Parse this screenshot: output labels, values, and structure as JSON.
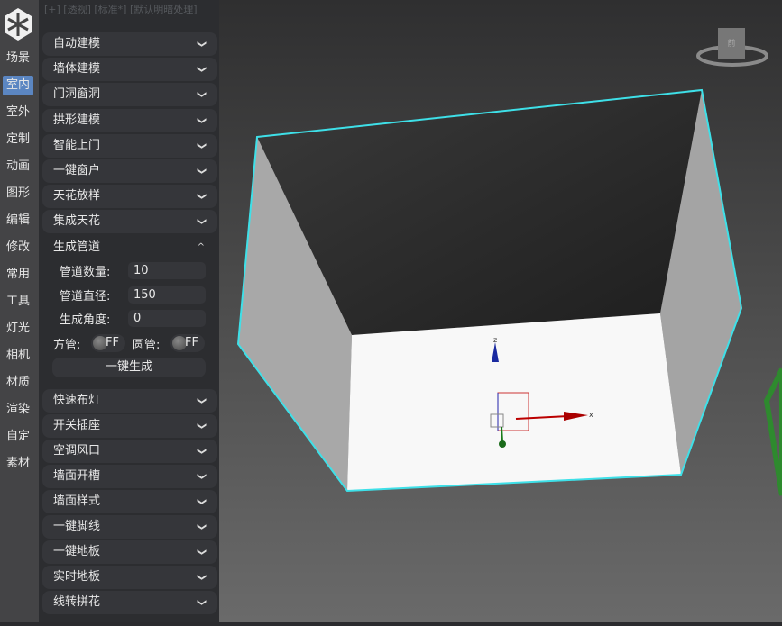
{
  "nav": [
    "场景",
    "室内",
    "室外",
    "定制",
    "动画",
    "图形",
    "编辑",
    "修改",
    "常用",
    "工具",
    "灯光",
    "相机",
    "材质",
    "渲染",
    "自定",
    "素材"
  ],
  "nav_active": 1,
  "viewport_label": "[+] [透视] [标准*] [默认明暗处理]",
  "sections_top": [
    "自动建模",
    "墙体建模",
    "门洞窗洞",
    "拱形建模",
    "智能上门",
    "一键窗户",
    "天花放样",
    "集成天花"
  ],
  "expanded": {
    "title": "生成管道",
    "fields": [
      {
        "label": "管道数量:",
        "value": "10"
      },
      {
        "label": "管道直径:",
        "value": "150"
      },
      {
        "label": "生成角度:",
        "value": "0"
      }
    ],
    "toggles": [
      {
        "label": "方管:",
        "state": "FF"
      },
      {
        "label": "圆管:",
        "state": "FF"
      }
    ],
    "button": "一键生成"
  },
  "sections_bottom": [
    "快速布灯",
    "开关插座",
    "空调风口",
    "墙面开槽",
    "墙面样式",
    "一键脚线",
    "一键地板",
    "实时地板",
    "线转拼花"
  ],
  "viewcube_label": "前",
  "colors": {
    "accent": "#5b86c2",
    "selection": "#3ee0e8"
  }
}
